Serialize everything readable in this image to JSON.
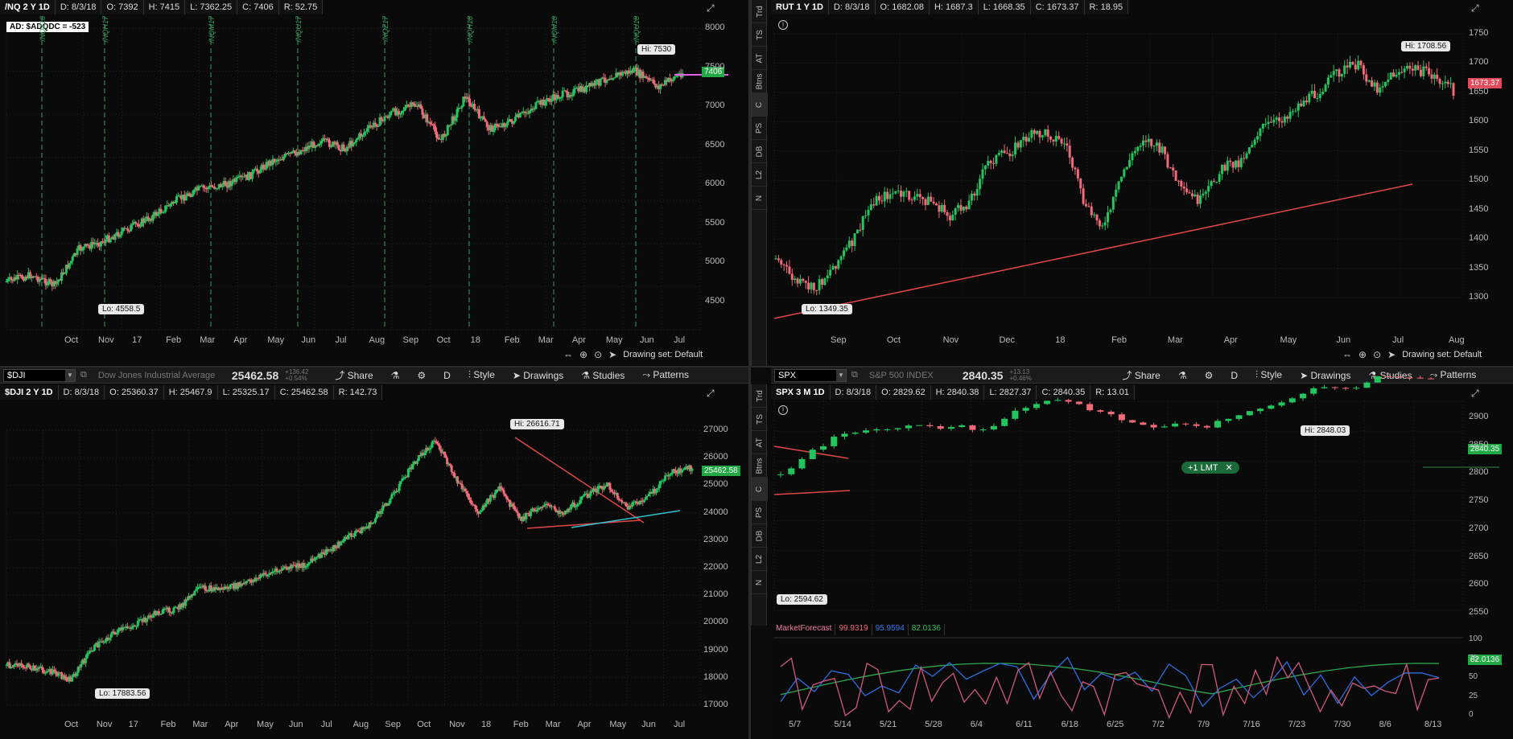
{
  "colors": {
    "up": "#22c55e",
    "down": "#f06a7a",
    "bg": "#0a0a0a",
    "grid": "#222222",
    "trend": "#e04848",
    "cyan": "#38c0d0",
    "pink": "#d05a7a",
    "blue": "#2f6ee0",
    "green_line": "#2ea84a"
  },
  "tl": {
    "header": {
      "symbol": "/NQ 2 Y 1D",
      "date": "D: 8/3/18",
      "open": "O: 7392",
      "high": "H: 7415",
      "low": "L: 7362.25",
      "close": "C: 7406",
      "range": "R: 52.75"
    },
    "study_label": "AD: $ADQDC = -523",
    "hi_label": "Hi: 7530",
    "lo_label": "Lo: 4558.5",
    "price_tag": "7406",
    "y_ticks": [
      "8000",
      "7500",
      "7000",
      "6500",
      "6000",
      "5500",
      "5000",
      "4500"
    ],
    "x_ticks": [
      "Oct",
      "Nov",
      "17",
      "Feb",
      "Mar",
      "Apr",
      "May",
      "Jun",
      "Jul",
      "Aug",
      "Sep",
      "Oct",
      "18",
      "Feb",
      "Mar",
      "Apr",
      "May",
      "Jun",
      "Jul"
    ],
    "expiry_labels": [
      "/NQZ16",
      "/NQH17",
      "/NQM17",
      "/NQU17",
      "/NQZ17",
      "/NQH18",
      "/NQM18",
      "/NQU18"
    ],
    "footer": "Drawing set: Default",
    "icon": "draw-icon"
  },
  "tr": {
    "header": {
      "symbol": "RUT 1 Y 1D",
      "date": "D: 8/3/18",
      "open": "O: 1682.08",
      "high": "H: 1687.3",
      "low": "L: 1668.35",
      "close": "C: 1673.37",
      "range": "R: 18.95"
    },
    "hi_label": "Hi: 1708.56",
    "lo_label": "Lo: 1349.35",
    "price_tag": "1673.37",
    "y_ticks": [
      "1750",
      "1700",
      "1650",
      "1600",
      "1550",
      "1500",
      "1450",
      "1400",
      "1350",
      "1300"
    ],
    "x_ticks": [
      "Sep",
      "Oct",
      "Nov",
      "Dec",
      "18",
      "Feb",
      "Mar",
      "Apr",
      "May",
      "Jun",
      "Jul",
      "Aug"
    ],
    "footer": "Drawing set: Default"
  },
  "vtabs": [
    "Trd",
    "TS",
    "AT",
    "Btns",
    "C",
    "PS",
    "DB",
    "L2",
    "N"
  ],
  "bl": {
    "toolbar": {
      "symbol": "$DJI",
      "name": "Dow Jones Industrial Average",
      "price": "25462.58",
      "change1": "+136.42",
      "change2": "+0.54%",
      "share": "Share",
      "period": "D",
      "style": "Style",
      "drawings": "Drawings",
      "studies": "Studies",
      "patterns": "Patterns"
    },
    "header": {
      "symbol": "$DJI 2 Y 1D",
      "date": "D: 8/3/18",
      "open": "O: 25360.37",
      "high": "H: 25467.9",
      "low": "L: 25325.17",
      "close": "C: 25462.58",
      "range": "R: 142.73"
    },
    "hi_label": "Hi: 26616.71",
    "lo_label": "Lo: 17883.56",
    "price_tag": "25462.58",
    "y_ticks": [
      "27000",
      "26000",
      "25000",
      "24000",
      "23000",
      "22000",
      "21000",
      "20000",
      "19000",
      "18000",
      "17000"
    ],
    "x_ticks": [
      "Oct",
      "Nov",
      "17",
      "Feb",
      "Mar",
      "Apr",
      "May",
      "Jun",
      "Jul",
      "Aug",
      "Sep",
      "Oct",
      "Nov",
      "18",
      "Feb",
      "Mar",
      "Apr",
      "May",
      "Jun",
      "Jul"
    ]
  },
  "br": {
    "toolbar": {
      "symbol": "SPX",
      "name": "S&P 500 INDEX",
      "price": "2840.35",
      "change1": "+13.13",
      "change2": "+0.46%",
      "share": "Share",
      "period": "D",
      "style": "Style",
      "drawings": "Drawings",
      "studies": "Studies",
      "patterns": "Patterns"
    },
    "header": {
      "symbol": "SPX 3 M 1D",
      "date": "D: 8/3/18",
      "open": "O: 2829.62",
      "high": "H: 2840.38",
      "low": "L: 2827.37",
      "close": "C: 2840.35",
      "range": "R: 13.01"
    },
    "hi_label": "Hi: 2848.03",
    "lo_label": "Lo: 2594.62",
    "order_label": "+1 LMT",
    "price_tag": "2840.35",
    "y_ticks": [
      "2900",
      "2850",
      "2800",
      "2750",
      "2700",
      "2650",
      "2600",
      "2550"
    ],
    "study": {
      "name": "MarketForecast",
      "v1": "99.9319",
      "v2": "95.9594",
      "v3": "82.0136",
      "tag": "82.0136",
      "y_ticks": [
        "100",
        "75",
        "50",
        "25",
        "0"
      ]
    },
    "x_ticks": [
      "5/7",
      "5/14",
      "5/21",
      "5/28",
      "6/4",
      "6/11",
      "6/18",
      "6/25",
      "7/2",
      "7/9",
      "7/16",
      "7/23",
      "7/30",
      "8/6",
      "8/13"
    ]
  }
}
